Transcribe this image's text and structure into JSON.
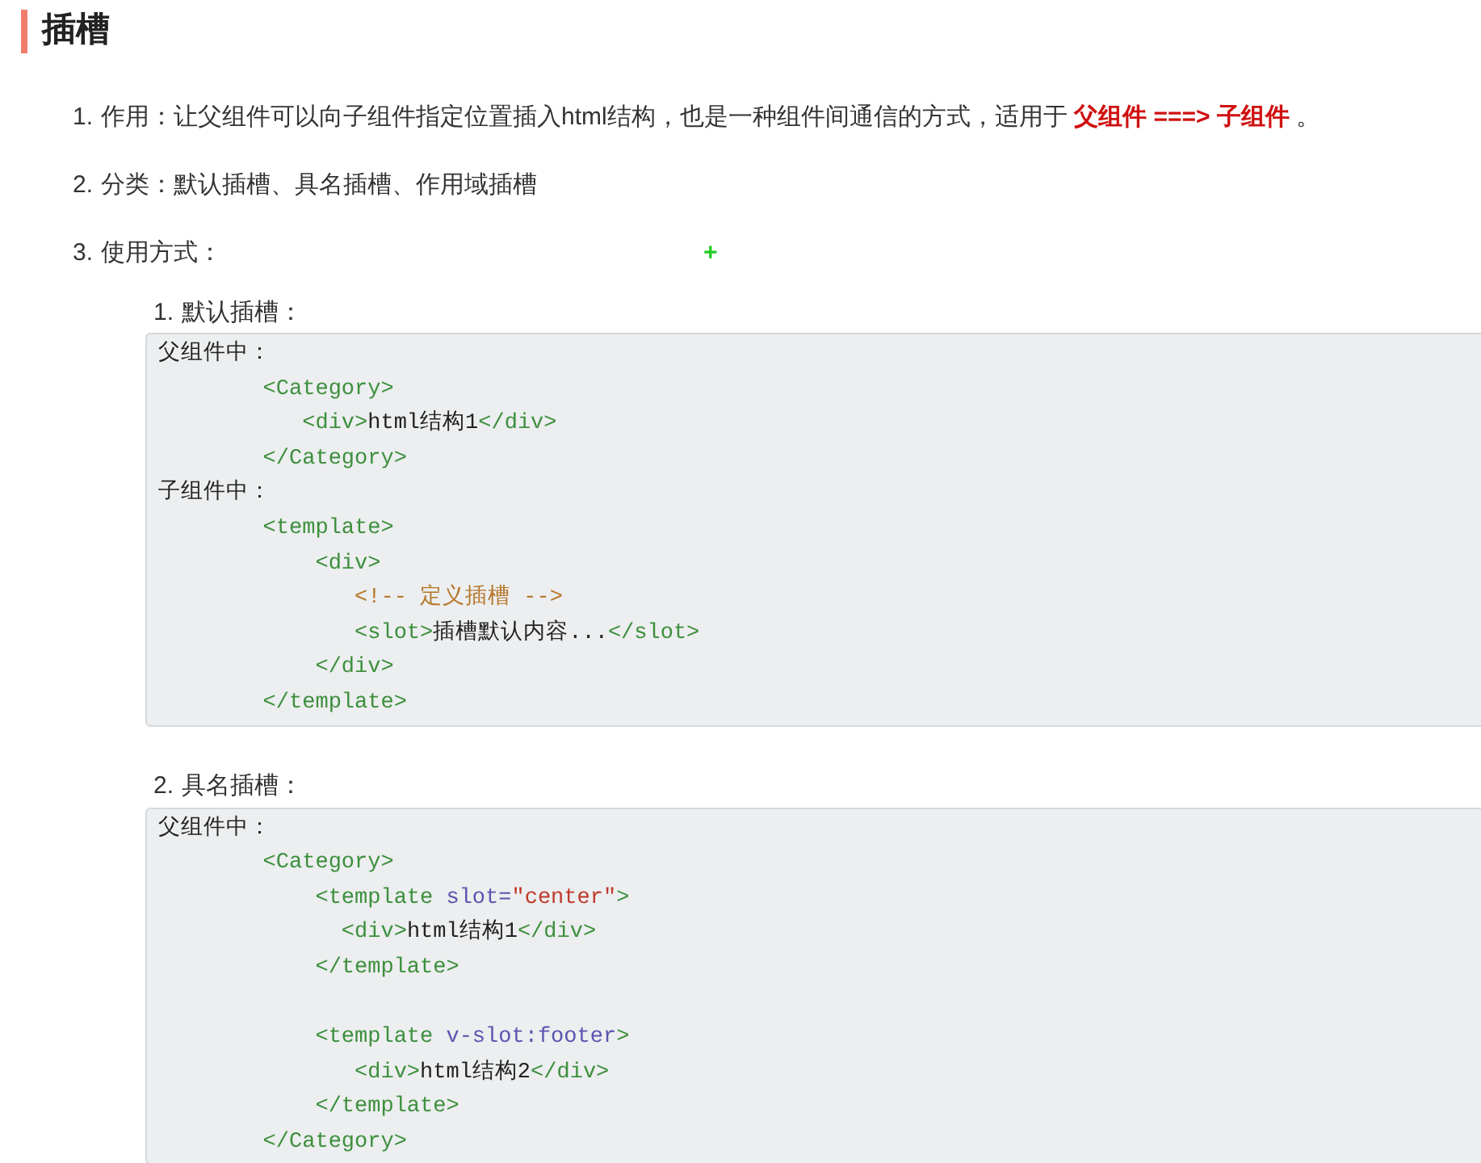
{
  "heading": "插槽",
  "items": [
    {
      "number": "1.",
      "text": "作用：让父组件可以向子组件指定位置插入html结构，也是一种组件间通信的方式，适用于 **父组件 ===> 子组件** 。"
    },
    {
      "number": "2.",
      "text": "分类：默认插槽、具名插槽、作用域插槽"
    },
    {
      "number": "3.",
      "text": "使用方式：",
      "marker": "+",
      "subitems": [
        {
          "number": "1.",
          "text": "默认插槽：",
          "code": [
            [
              {
                "kind": "text",
                "text": "父组件中："
              }
            ],
            [
              {
                "kind": "tag",
                "text": "        <Category>"
              }
            ],
            [
              {
                "kind": "tag",
                "text": "           <div>"
              },
              {
                "kind": "text",
                "text": "html结构1"
              },
              {
                "kind": "tag",
                "text": "</div>"
              }
            ],
            [
              {
                "kind": "tag",
                "text": "        </Category>"
              }
            ],
            [
              {
                "kind": "text",
                "text": "子组件中："
              }
            ],
            [
              {
                "kind": "tag",
                "text": "        <template>"
              }
            ],
            [
              {
                "kind": "tag",
                "text": "            <div>"
              }
            ],
            [
              {
                "kind": "comment",
                "text": "               <!-- 定义插槽 -->"
              }
            ],
            [
              {
                "kind": "tag",
                "text": "               <slot>"
              },
              {
                "kind": "text",
                "text": "插槽默认内容..."
              },
              {
                "kind": "tag",
                "text": "</slot>"
              }
            ],
            [
              {
                "kind": "tag",
                "text": "            </div>"
              }
            ],
            [
              {
                "kind": "tag",
                "text": "        </template>"
              }
            ]
          ]
        },
        {
          "number": "2.",
          "text": "具名插槽：",
          "code": [
            [
              {
                "kind": "text",
                "text": "父组件中："
              }
            ],
            [
              {
                "kind": "tag",
                "text": "        <Category>"
              }
            ],
            [
              {
                "kind": "tag",
                "text": "            <template "
              },
              {
                "kind": "attr",
                "text": "slot="
              },
              {
                "kind": "string",
                "text": "\"center\""
              },
              {
                "kind": "tag",
                "text": ">"
              }
            ],
            [
              {
                "kind": "tag",
                "text": "              <div>"
              },
              {
                "kind": "text",
                "text": "html结构1"
              },
              {
                "kind": "tag",
                "text": "</div>"
              }
            ],
            [
              {
                "kind": "tag",
                "text": "            </template>"
              }
            ],
            [
              {
                "kind": "blank"
              }
            ],
            [
              {
                "kind": "tag",
                "text": "            <template "
              },
              {
                "kind": "attr",
                "text": "v-slot:footer"
              },
              {
                "kind": "tag",
                "text": ">"
              }
            ],
            [
              {
                "kind": "tag",
                "text": "               <div>"
              },
              {
                "kind": "text",
                "text": "html结构2"
              },
              {
                "kind": "tag",
                "text": "</div>"
              }
            ],
            [
              {
                "kind": "tag",
                "text": "            </template>"
              }
            ],
            [
              {
                "kind": "tag",
                "text": "        </Category>"
              }
            ]
          ]
        }
      ]
    }
  ]
}
